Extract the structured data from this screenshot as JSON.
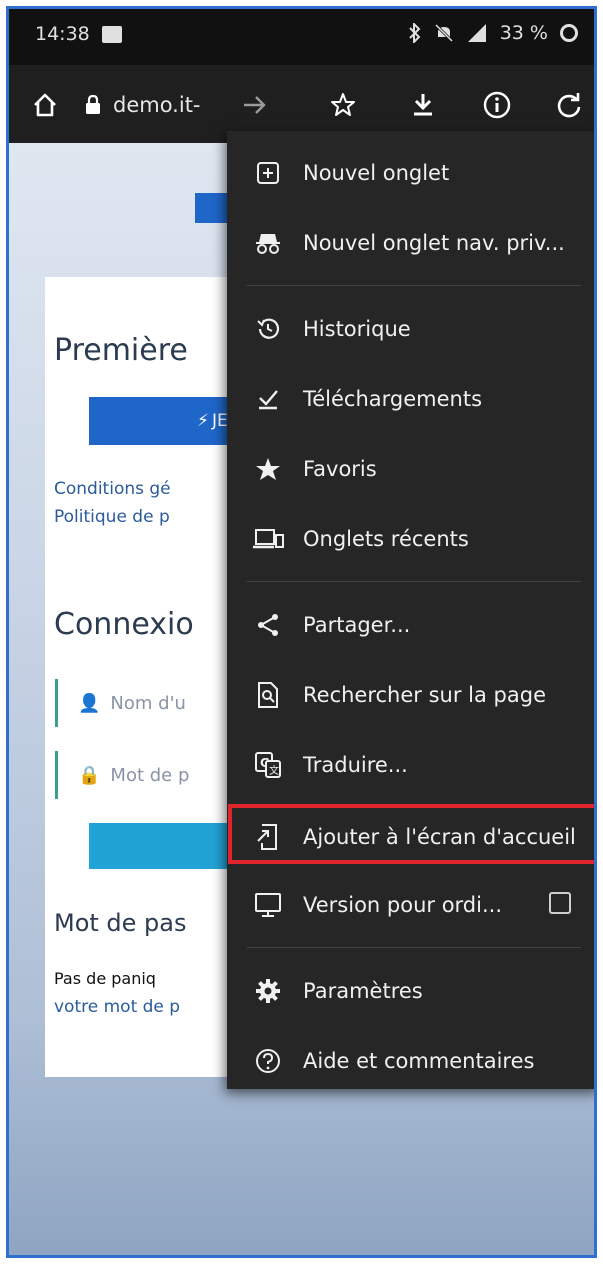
{
  "status_bar": {
    "time": "14:38",
    "battery": "33 %"
  },
  "toolbar": {
    "url": "demo.it-"
  },
  "webpage": {
    "first_heading": "Première",
    "button_fragment": "JE",
    "link1": "Conditions gé",
    "link2": "Politique de p",
    "login_heading": "Connexio",
    "username_placeholder": "Nom d'u",
    "password_placeholder": "Mot de p",
    "forgot_heading": "Mot de pas",
    "forgot_text1": "Pas de paniq",
    "forgot_text2": "votre mot de p"
  },
  "menu": {
    "items": [
      {
        "label": "Nouvel onglet",
        "icon": "new-tab-icon"
      },
      {
        "label": "Nouvel onglet nav. priv...",
        "icon": "incognito-icon"
      },
      {
        "label": "Historique",
        "icon": "history-icon"
      },
      {
        "label": "Téléchargements",
        "icon": "downloads-icon"
      },
      {
        "label": "Favoris",
        "icon": "star-icon"
      },
      {
        "label": "Onglets récents",
        "icon": "devices-icon"
      },
      {
        "label": "Partager...",
        "icon": "share-icon"
      },
      {
        "label": "Rechercher sur la page",
        "icon": "find-in-page-icon"
      },
      {
        "label": "Traduire...",
        "icon": "translate-icon"
      },
      {
        "label": "Ajouter à l'écran d'accueil",
        "icon": "add-to-home-icon"
      },
      {
        "label": "Version pour ordi...",
        "icon": "desktop-icon"
      },
      {
        "label": "Paramètres",
        "icon": "settings-icon"
      },
      {
        "label": "Aide et commentaires",
        "icon": "help-icon"
      }
    ]
  },
  "colors": {
    "menu_bg": "#262626",
    "highlight": "#e0242b",
    "primary_blue": "#1f66c9",
    "frame_border": "#2f6fd0"
  }
}
